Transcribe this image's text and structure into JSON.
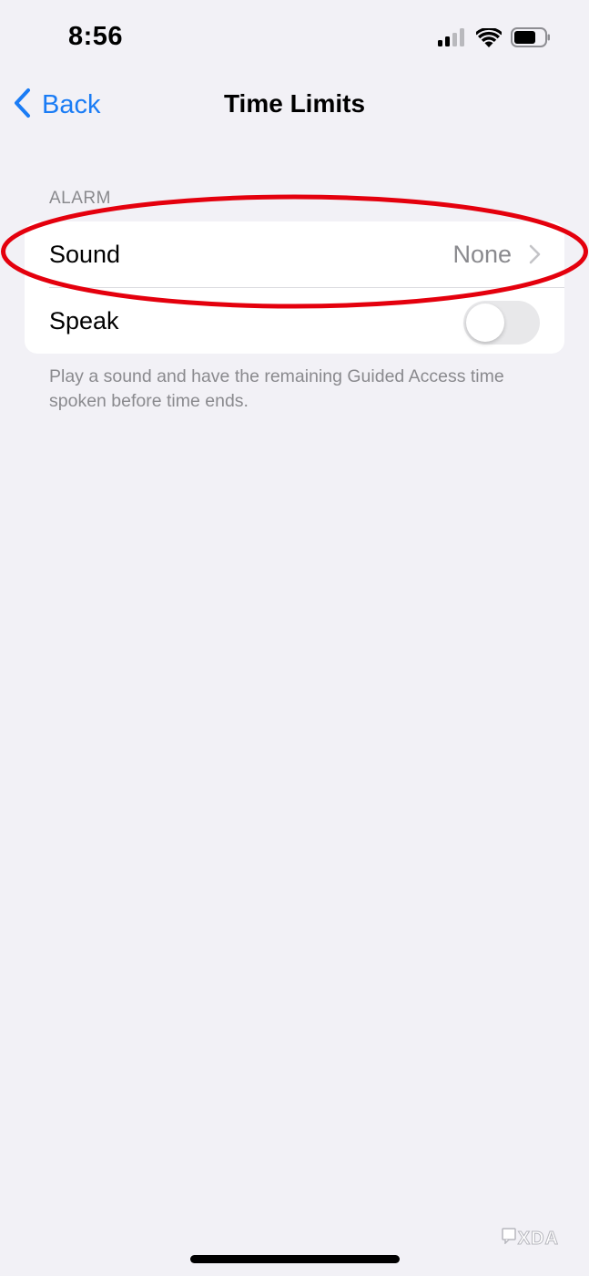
{
  "status_bar": {
    "time": "8:56",
    "icons": [
      "cellular-signal-icon",
      "wifi-icon",
      "battery-icon"
    ]
  },
  "nav": {
    "back_label": "Back",
    "title": "Time Limits"
  },
  "alarm_section": {
    "header": "ALARM",
    "rows": [
      {
        "label": "Sound",
        "value": "None",
        "accessory": "chevron-right-icon"
      },
      {
        "label": "Speak",
        "toggle_on": false
      }
    ],
    "footer": "Play a sound and have the remaining Guided Access time spoken before time ends."
  },
  "watermark": {
    "text": "XDA"
  },
  "colors": {
    "accent": "#1a7cf5",
    "background": "#f2f1f6",
    "annotation": "#e4000d",
    "secondary_text": "#8a8a8e"
  }
}
